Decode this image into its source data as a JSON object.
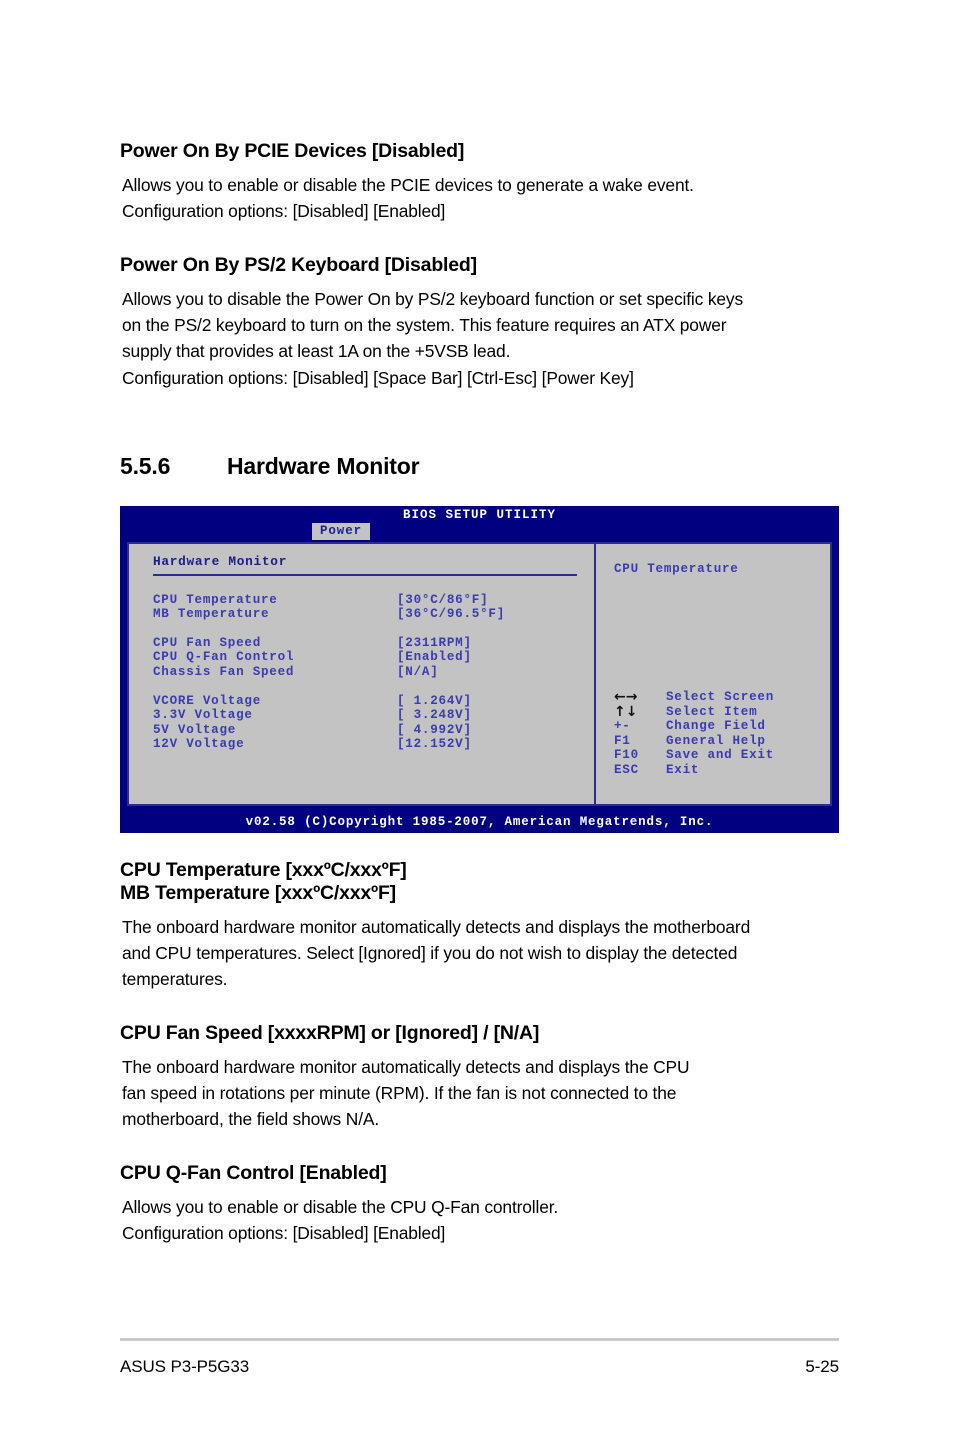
{
  "sections": [
    {
      "heading": "Power On By PCIE Devices [Disabled]",
      "body": [
        "Allows you to enable or disable the PCIE devices to generate a wake event.",
        "Configuration options: [Disabled] [Enabled]"
      ]
    },
    {
      "heading": "Power On By PS/2 Keyboard [Disabled]",
      "body": [
        "Allows you to disable the Power On by PS/2 keyboard function or set specific keys",
        "on the PS/2 keyboard to turn on the system. This feature requires an ATX power",
        "supply that provides at least 1A on the +5VSB lead.",
        "Configuration options: [Disabled] [Space Bar] [Ctrl-Esc] [Power Key]"
      ]
    }
  ],
  "chapter": {
    "number": "5.5.6",
    "title": "Hardware Monitor"
  },
  "bios": {
    "title": "BIOS SETUP UTILITY",
    "tab": "Power",
    "panel_title": "Hardware Monitor",
    "groups": [
      {
        "rows": [
          {
            "label": "CPU Temperature",
            "value": "[30°C/86°F]"
          },
          {
            "label": "MB Temperature",
            "value": "[36°C/96.5°F]"
          }
        ]
      },
      {
        "rows": [
          {
            "label": "CPU Fan Speed",
            "value": "[2311RPM]"
          },
          {
            "label": "CPU Q-Fan Control",
            "value": "[Enabled]"
          },
          {
            "label": "Chassis Fan Speed",
            "value": "[N/A]"
          }
        ]
      },
      {
        "rows": [
          {
            "label": "VCORE Voltage",
            "value": "[ 1.264V]"
          },
          {
            "label": "3.3V Voltage",
            "value": "[ 3.248V]"
          },
          {
            "label": "5V Voltage",
            "value": "[ 4.992V]"
          },
          {
            "label": "12V Voltage",
            "value": "[12.152V]"
          }
        ]
      }
    ],
    "help_title": "CPU Temperature",
    "keys": [
      {
        "key": "←→",
        "glyph": true,
        "action": "Select Screen"
      },
      {
        "key": "↑↓",
        "glyph": true,
        "action": "Select Item"
      },
      {
        "key": "+-",
        "glyph": false,
        "action": "Change Field"
      },
      {
        "key": "F1",
        "glyph": false,
        "action": "General Help"
      },
      {
        "key": "F10",
        "glyph": false,
        "action": "Save and Exit"
      },
      {
        "key": "ESC",
        "glyph": false,
        "action": "Exit"
      }
    ],
    "footer": "v02.58 (C)Copyright 1985-2007, American Megatrends, Inc."
  },
  "sections_after": [
    {
      "heading_lines": [
        "CPU Temperature [xxxºC/xxxºF]",
        "MB Temperature [xxxºC/xxxºF]"
      ],
      "body": [
        "The onboard hardware monitor automatically detects and displays the motherboard",
        "and CPU temperatures. Select [Ignored] if you do not wish to display the detected",
        "temperatures."
      ]
    },
    {
      "heading_lines": [
        "CPU Fan Speed [xxxxRPM] or [Ignored] / [N/A]"
      ],
      "body": [
        "The onboard hardware monitor automatically detects and displays the CPU",
        "fan speed in rotations per minute (RPM). If the fan is not connected to the",
        "motherboard, the field shows N/A."
      ]
    },
    {
      "heading_lines": [
        "CPU Q-Fan Control [Enabled]"
      ],
      "body": [
        "Allows you to enable or disable the CPU Q-Fan controller.",
        "Configuration options: [Disabled] [Enabled]"
      ]
    }
  ],
  "page_footer": {
    "left": "ASUS P3-P5G33",
    "right": "5-25"
  },
  "colors": {
    "bios_header_bg": "#000080",
    "bios_panel_bg": "#c3c3c3",
    "bios_border": "#2d2d8f",
    "bios_text": "#3b3bb0",
    "bios_title_text": "#ffffff",
    "tab_text": "#202090"
  }
}
